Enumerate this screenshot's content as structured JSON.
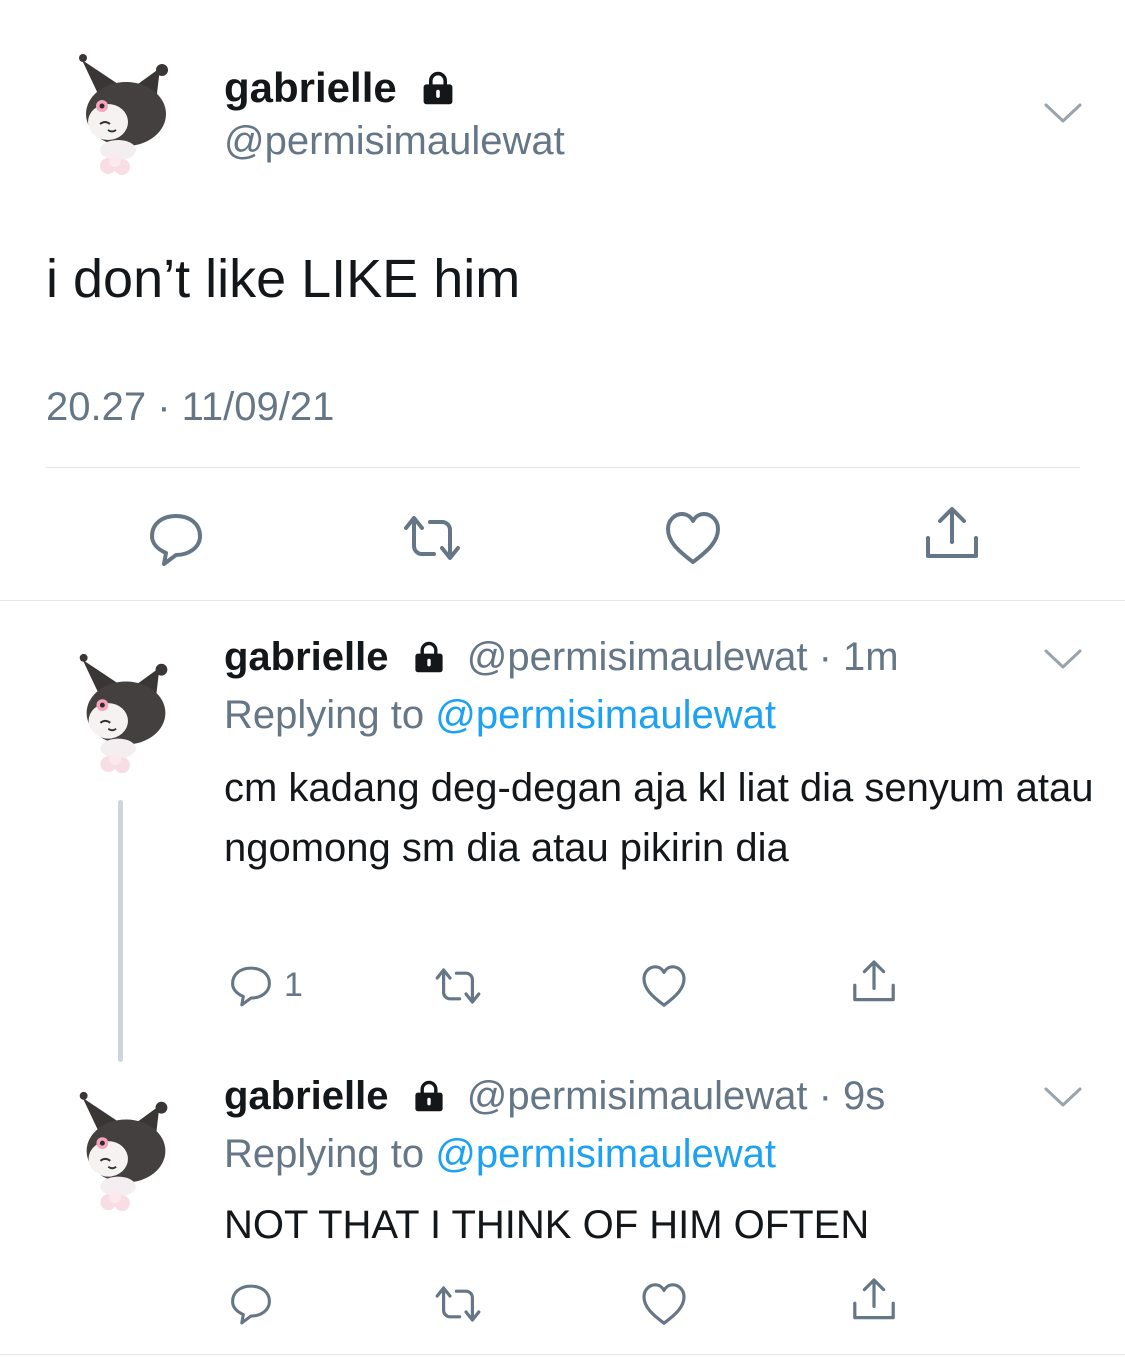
{
  "main_tweet": {
    "display_name": "gabrielle",
    "handle": "@permisimaulewat",
    "text": "i don’t like LIKE him",
    "timestamp": "20.27 · 11/09/21"
  },
  "replies": [
    {
      "display_name": "gabrielle",
      "handle": "@permisimaulewat",
      "age": "· 1m",
      "replying_prefix": "Replying to",
      "replying_to": "@permisimaulewat",
      "text": "cm kadang deg-degan aja kl liat dia senyum atau ngomong sm dia atau pikirin dia",
      "reply_count": "1"
    },
    {
      "display_name": "gabrielle",
      "handle": "@permisimaulewat",
      "age": "· 9s",
      "replying_prefix": "Replying to",
      "replying_to": "@permisimaulewat",
      "text": "NOT THAT I THINK OF HIM OFTEN"
    }
  ],
  "icons": [
    "avatar-kuromi",
    "lock-icon",
    "chevron-down-icon",
    "reply-icon",
    "retweet-icon",
    "like-icon",
    "share-icon"
  ],
  "colors": {
    "text": "#14171a",
    "secondary": "#657786",
    "link": "#1da1f2",
    "divider": "#e1e8ed",
    "thread_line": "#ccd6dd"
  }
}
